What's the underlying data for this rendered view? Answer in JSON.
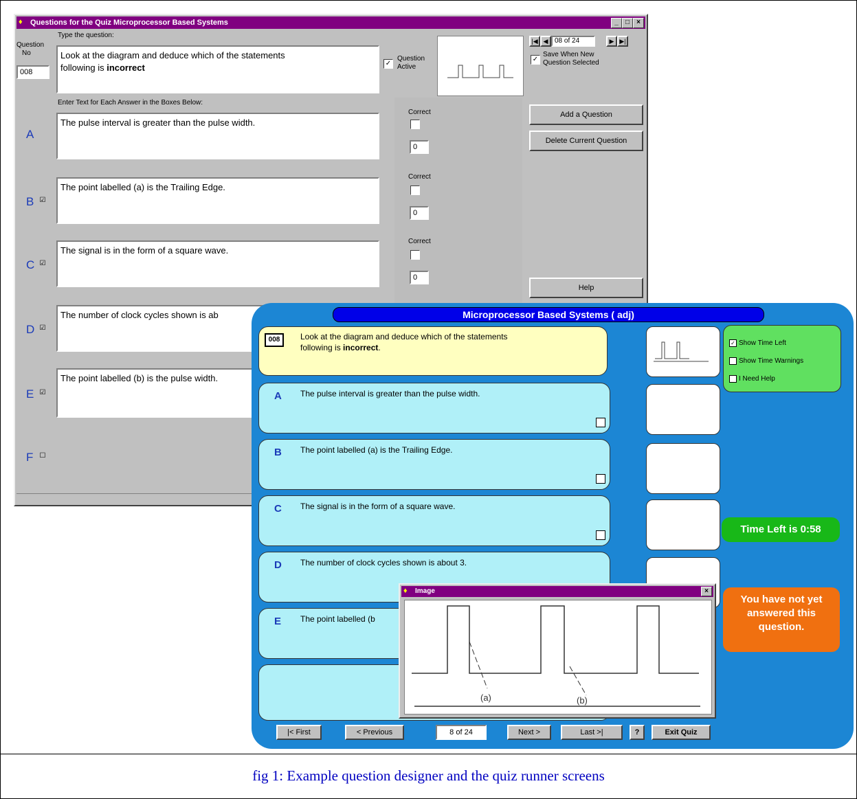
{
  "designer": {
    "title": "Questions for the Quiz Microprocessor Based Systems",
    "type_question_label": "Type the question:",
    "question_no_label_1": "Question",
    "question_no_label_2": "No",
    "question_no": "008",
    "question_text_1": "Look at the diagram and deduce which of the statements",
    "question_text_2": "following is ",
    "question_text_bold": "incorrect",
    "question_active_label_1": "Question",
    "question_active_label_2": "Active",
    "nav_record": "08 of 24",
    "save_label_1": "Save When New",
    "save_label_2": "Question Selected",
    "answers_label": "Enter Text for Each Answer in the Boxes Below:",
    "correct_label": "Correct",
    "add_question": "Add a Question",
    "delete_question": "Delete Current Question",
    "help": "Help",
    "answers": [
      {
        "letter": "A",
        "enabled": "",
        "text": "The pulse interval is greater than the pulse width.",
        "score": "0"
      },
      {
        "letter": "B",
        "enabled": "☑",
        "text": "The point labelled (a) is the Trailing Edge.",
        "score": "0"
      },
      {
        "letter": "C",
        "enabled": "☑",
        "text": "The signal is in the form of a square wave.",
        "score": "0"
      },
      {
        "letter": "D",
        "enabled": "☑",
        "text": "The number of  clock cycles shown is ab"
      },
      {
        "letter": "E",
        "enabled": "☑",
        "text": "The point labelled (b) is the pulse width."
      },
      {
        "letter": "F",
        "enabled": "☐"
      }
    ]
  },
  "runner": {
    "title": "Microprocessor Based Systems ( adj)",
    "qnum": "008",
    "question_1": "Look at the diagram and deduce which of the statements",
    "question_2": "following is ",
    "question_bold": "incorrect",
    "answers": [
      {
        "letter": "A",
        "text": "The pulse interval is greater than the pulse width."
      },
      {
        "letter": "B",
        "text": "The point labelled (a) is the Trailing Edge."
      },
      {
        "letter": "C",
        "text": "The signal is in the form of a square wave."
      },
      {
        "letter": "D",
        "text": "The number of  clock cycles shown is about 3."
      },
      {
        "letter": "E",
        "text": "The point labelled (b"
      }
    ],
    "show_time_left": "Show Time Left",
    "show_time_warnings": "Show Time Warnings",
    "need_help": "I Need Help",
    "time_left": "Time Left is 0:58",
    "warning": "You have not yet answered this question.",
    "nav": {
      "first": "|< First",
      "previous": "< Previous",
      "position": "8 of 24",
      "next": "Next >",
      "last": "Last >|",
      "help": "?",
      "exit": "Exit Quiz"
    }
  },
  "image_popup": {
    "title": "Image",
    "label_a": "(a)",
    "label_b": "(b)"
  },
  "caption": "fig 1: Example question designer and the quiz runner screens",
  "colors": {
    "titlebar": "#800080",
    "runner_bg": "#1c86d4",
    "question_bg": "#ffffc0",
    "answer_bg": "#b0f0f8",
    "options_bg": "#60e060",
    "time_bg": "#18b818",
    "warning_bg": "#f07010"
  }
}
